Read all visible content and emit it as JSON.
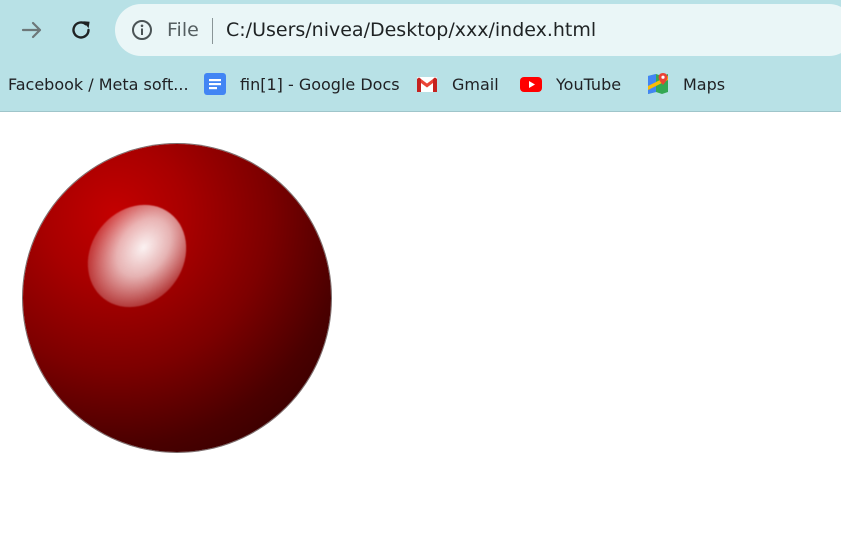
{
  "toolbar": {
    "scheme_label": "File",
    "url": "C:/Users/nivea/Desktop/xxx/index.html"
  },
  "bookmarks": [
    {
      "label": "Facebook / Meta soft...",
      "icon": "none"
    },
    {
      "label": "fin[1] - Google Docs",
      "icon": "google-docs-icon"
    },
    {
      "label": "Gmail",
      "icon": "gmail-icon"
    },
    {
      "label": "YouTube",
      "icon": "youtube-icon"
    },
    {
      "label": "Maps",
      "icon": "google-maps-icon"
    }
  ],
  "colors": {
    "chrome_background": "#b8e1e6",
    "omnibox_background": "#eaf6f7",
    "ball_light": "#c40000",
    "ball_dark": "#250000"
  }
}
